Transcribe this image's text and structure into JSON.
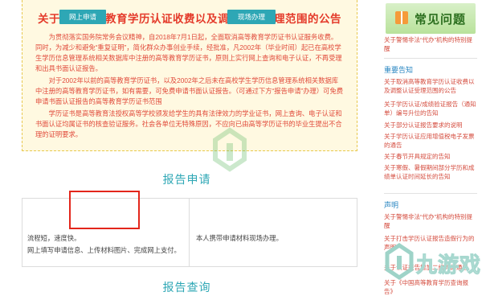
{
  "notice": {
    "title": "关于取消高等教育学历认证收费以及调整认证受理范围的公告",
    "p1": "为贯彻落实国务院常务会议精神，自2018年7月1日起，全面取消高等教育学历证书认证服务收费。同时，为减少和避免“重复证明”，简化群众办事创业手续，经批准，凡2002年（毕业时间）起已在高校学生学历信息管理系统相关数据库中注册的高等教育学历证书，原则上实行网上查询和电子认证，不再受理和出具书面认证报告。",
    "p2": "对于2002年以前的高等教育学历证书，以及2002年之后未在高校学生学历信息管理系统相关数据库中注册的高等教育学历证书，如有需要，可免费申请书面认证报告。（可通过下方“报告申请”办理）可免费申请书面认证报告的高等教育学历证书范围",
    "p3": "学历证书是高等教育法授权高等学校颁发给学生的具有法律效力的学业证书，网上查询、电子认证和书面认证均属证书的核查验证服务。社会各单位无特殊原因，不应向已由高等学历证书的毕业生提出不合理的证明要求。"
  },
  "report_apply": {
    "title": "报告申请",
    "online_button": "网上申请",
    "onsite_button": "现场办理",
    "online_desc1": "流程短，速度快。",
    "online_desc2": "网上填写申请信息、上传材料图片、完成网上支付。",
    "onsite_desc": "本人携带申请材料现场办理。"
  },
  "report_query": {
    "title": "报告查询"
  },
  "sidebar": {
    "faq_title": "常见问题",
    "faq_link": "关于警惕非法“代办”机构的特别提醒",
    "important_head": "重要告知",
    "important_links": [
      "关于取消高等教育学历认证收费以及调整认证受理范围的公告",
      "关于学历认证/成绩验证报告（通知单）编号升位的告知",
      "关于部分认证报告要求的说明",
      "关于学历认证应用增值税电子发票的通告",
      "关于春节开具规定的告知",
      "关于寒假、暑假期间部分学历和成绩单认证时间延长的告知"
    ],
    "statement_head": "声明",
    "statement_links": [
      "关于警惕非法“代办”机构的特别提醒",
      "关于打击学历认证报告造假行为的声明",
      "关于认证报告增加二维码的通告",
      "关于《中国高等教育学历查询报告》"
    ]
  },
  "watermark": {
    "text": "九游戏"
  }
}
